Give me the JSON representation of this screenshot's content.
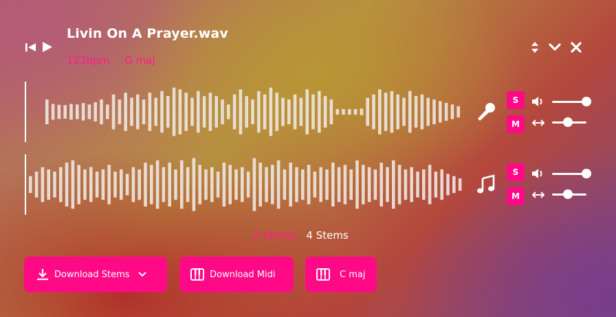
{
  "header": {
    "title": "Livin On A Prayer.wav",
    "bpm": "123bpm",
    "key": "G maj"
  },
  "icons": {
    "previous": "skip-previous-icon",
    "play": "play-icon",
    "resize": "resize-vertical-icon",
    "collapse": "chevron-down-icon",
    "close": "close-icon",
    "vocals": "microphone-icon",
    "music": "music-note-icon",
    "volume": "volume-icon",
    "pan": "pan-arrows-icon"
  },
  "tracks": [
    {
      "solo_label": "S",
      "mute_label": "M",
      "volume": 1.0,
      "pan": 0.45,
      "bars": [
        0.44,
        0.28,
        0.25,
        0.24,
        0.28,
        0.26,
        0.31,
        0.26,
        0.34,
        0.44,
        0.26,
        0.62,
        0.44,
        0.68,
        0.5,
        0.62,
        0.44,
        0.68,
        0.5,
        0.74,
        0.56,
        0.86,
        0.8,
        0.68,
        0.5,
        0.74,
        0.56,
        0.68,
        0.56,
        0.44,
        0.26,
        0.62,
        0.8,
        0.56,
        0.44,
        0.74,
        0.62,
        0.86,
        0.68,
        0.5,
        0.44,
        0.62,
        0.5,
        0.8,
        0.62,
        0.74,
        0.56,
        0.44,
        0.1,
        0.1,
        0.1,
        0.1,
        0.12,
        0.5,
        0.62,
        0.8,
        0.68,
        0.74,
        0.62,
        0.5,
        0.74,
        0.56,
        0.62,
        0.5,
        0.44,
        0.38,
        0.32,
        0.26,
        0.2,
        0.14,
        0.0
      ]
    },
    {
      "solo_label": "S",
      "mute_label": "M",
      "volume": 1.0,
      "pan": 0.45,
      "bars": [
        0.3,
        0.46,
        0.62,
        0.54,
        0.46,
        0.62,
        0.78,
        0.86,
        0.7,
        0.54,
        0.62,
        0.46,
        0.54,
        0.7,
        0.46,
        0.54,
        0.38,
        0.62,
        0.54,
        0.78,
        0.7,
        0.86,
        0.62,
        0.78,
        0.54,
        0.86,
        0.62,
        0.94,
        0.7,
        0.54,
        0.62,
        0.46,
        0.78,
        0.7,
        0.54,
        0.62,
        0.46,
        0.94,
        0.78,
        0.62,
        0.7,
        0.86,
        0.54,
        0.78,
        0.62,
        0.54,
        0.7,
        0.46,
        0.62,
        0.54,
        0.78,
        0.62,
        0.7,
        0.54,
        0.86,
        0.7,
        0.62,
        0.54,
        0.78,
        0.62,
        0.86,
        0.7,
        0.54,
        0.62,
        0.46,
        0.54,
        0.7,
        0.46,
        0.54,
        0.38,
        0.3,
        0.22,
        0.08
      ]
    }
  ],
  "stems_toggle": {
    "option_2": "2 Stems",
    "option_4": "4 Stems"
  },
  "buttons": {
    "download_stems": "Download Stems",
    "download_midi": "Download Midi",
    "key_button": "C maj"
  }
}
